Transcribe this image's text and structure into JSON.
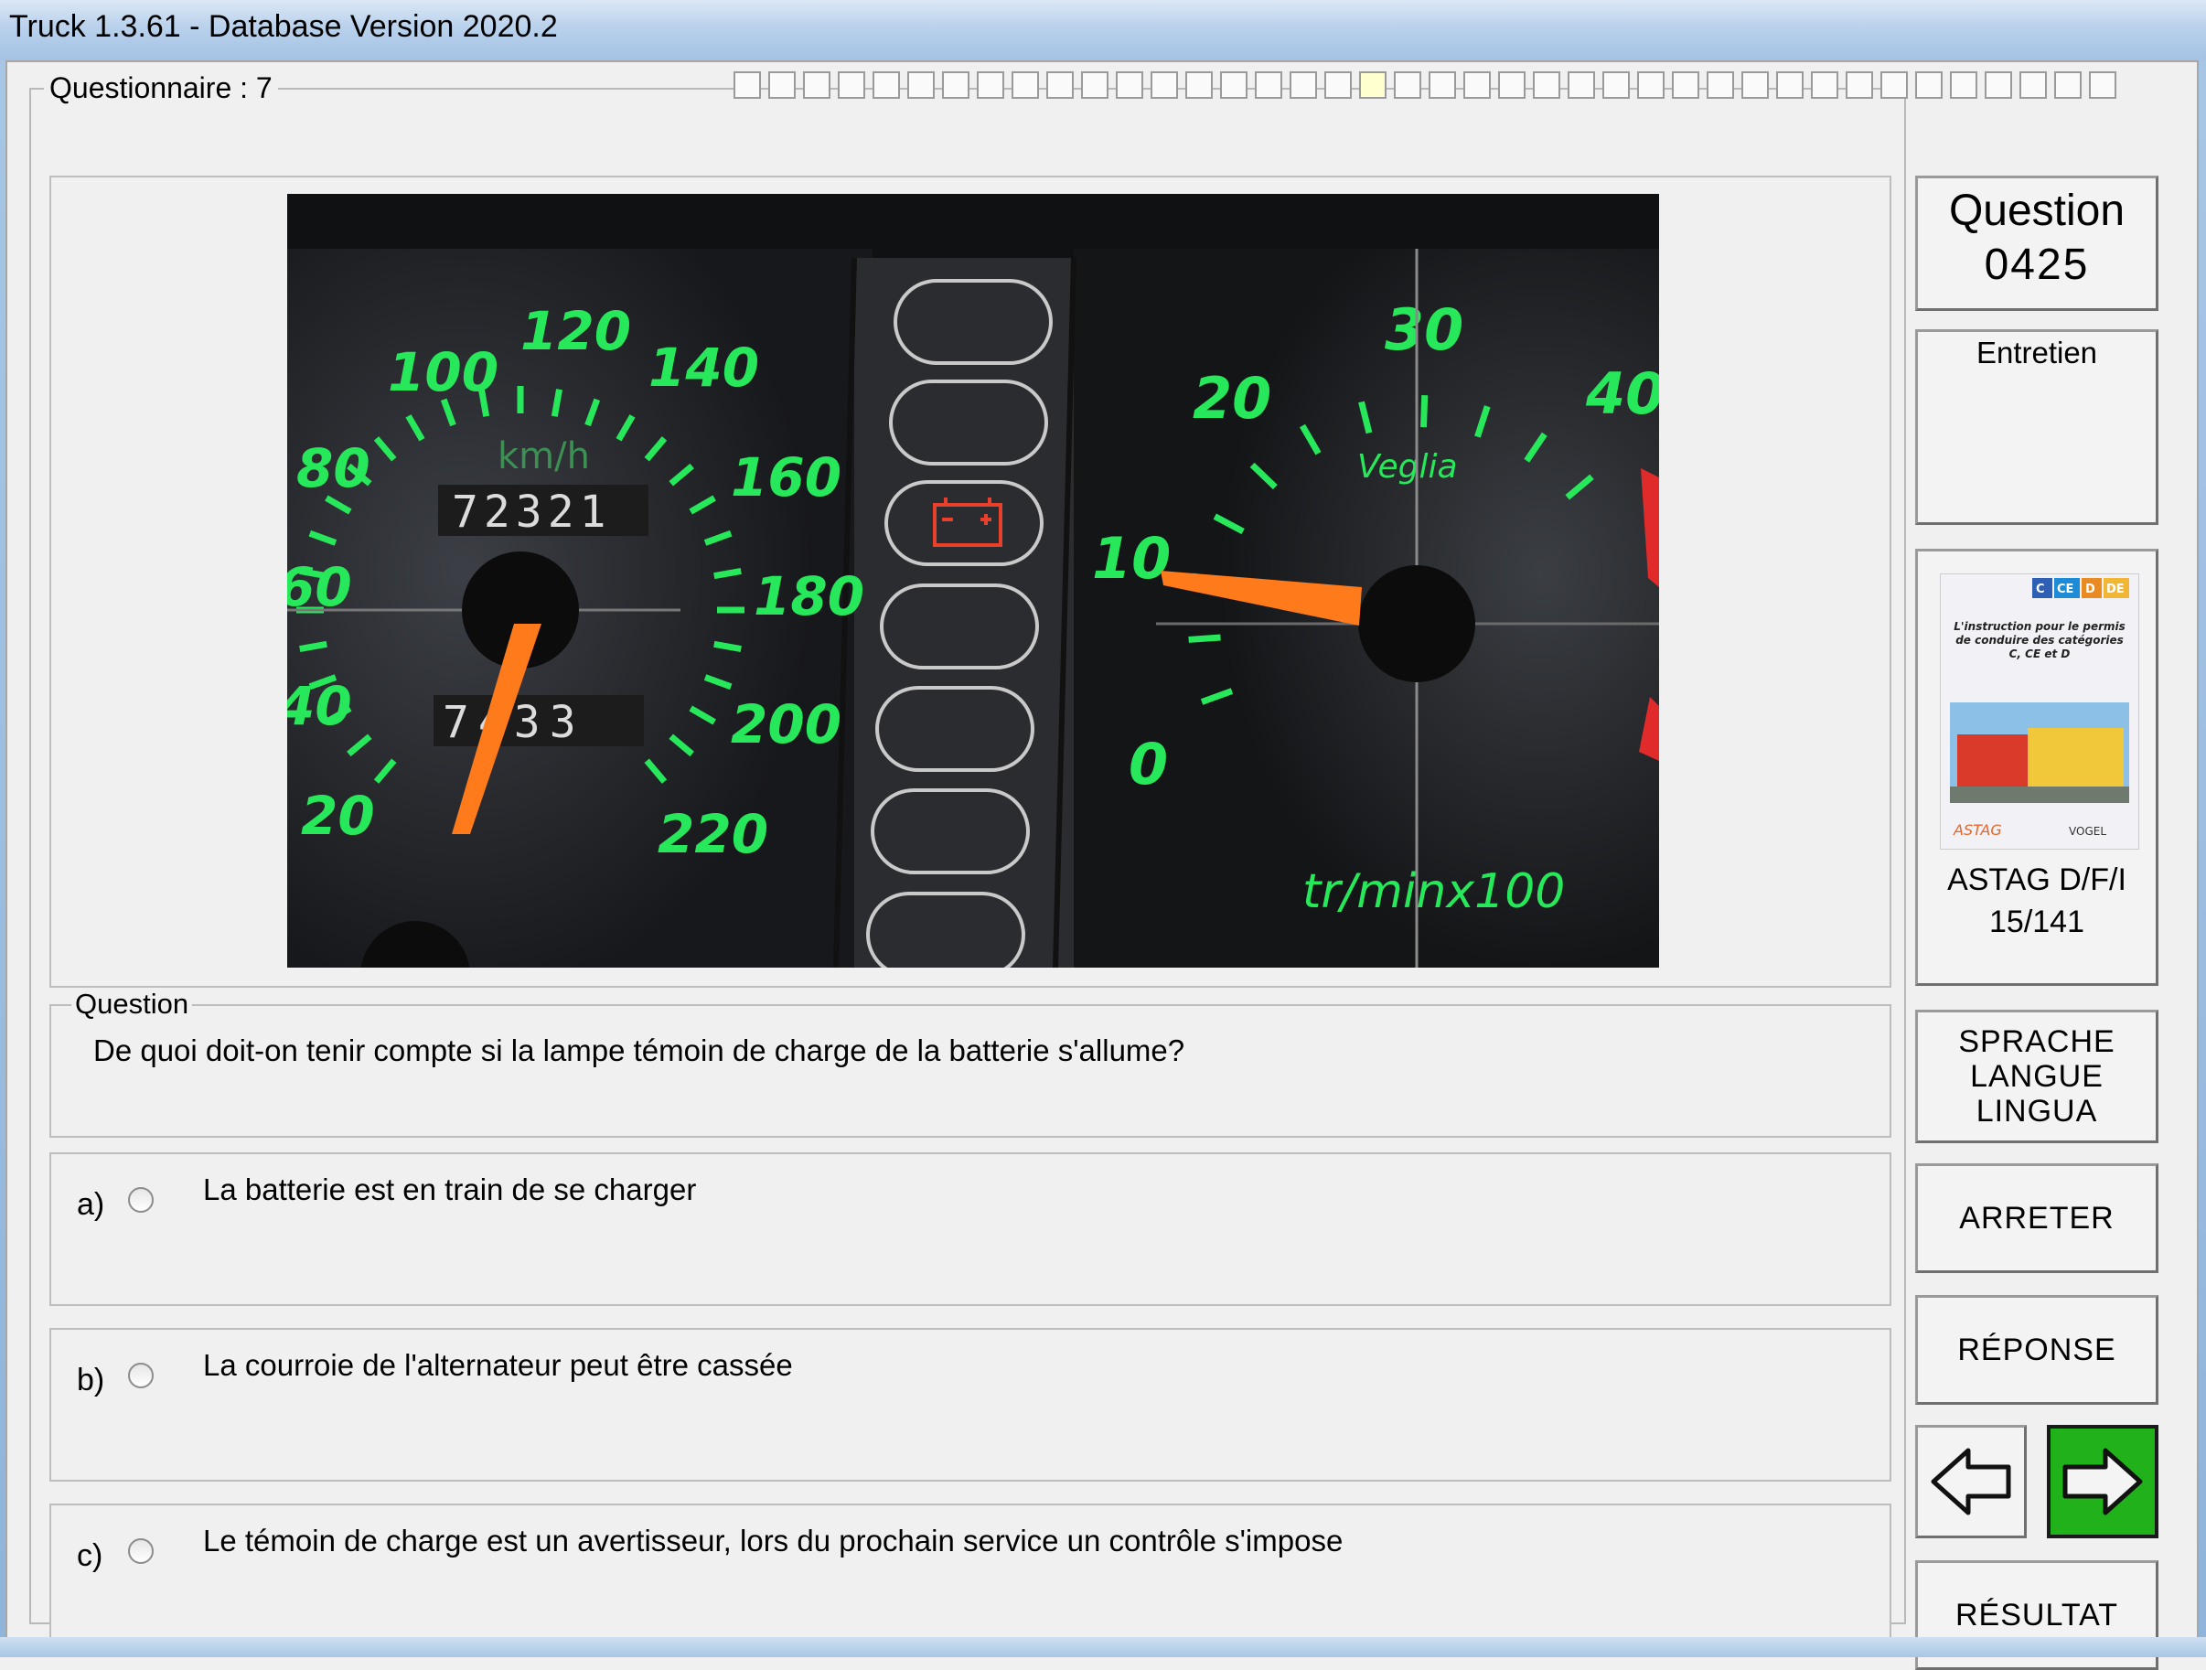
{
  "window": {
    "title": "Truck 1.3.61 - Database Version 2020.2"
  },
  "questionnaire": {
    "legend": "Questionnaire : 7",
    "progress_total": 40,
    "progress_current_index": 18
  },
  "dashboard": {
    "speed_labels": [
      "20",
      "40",
      "60",
      "80",
      "100",
      "120",
      "140",
      "160",
      "180",
      "200",
      "220"
    ],
    "speed_unit": "km/h",
    "odometer": "72321",
    "trip": "7433",
    "rpm_labels": [
      "0",
      "10",
      "20",
      "30",
      "40"
    ],
    "brand": "Veglia",
    "rpm_unit": "tr/minx100",
    "battery_warning_color": "#e8402a",
    "gauge_color": "#27e85a",
    "needle_color": "#ff7a1a"
  },
  "question": {
    "legend": "Question",
    "text": "De quoi doit-on tenir compte si la lampe témoin de charge de la batterie s'allume?"
  },
  "answers": [
    {
      "letter": "a)",
      "text": "La batterie est en train de se charger",
      "checked": false
    },
    {
      "letter": "b)",
      "text": "La courroie de l'alternateur peut être cassée",
      "checked": false
    },
    {
      "letter": "c)",
      "text": "Le témoin de charge est un avertisseur, lors du prochain service un contrôle s'impose",
      "checked": false
    }
  ],
  "sidebar": {
    "question_label": "Question",
    "question_number": "0425",
    "category": "Entretien",
    "book": {
      "badges": [
        "C",
        "CE",
        "D",
        "DE"
      ],
      "cover_text": "L'instruction pour le permis de conduire des catégories C, CE et D",
      "publisher_left": "ASTAG",
      "publisher_right": "VOGEL",
      "label": "ASTAG D/F/I",
      "pages": "15/141"
    },
    "lang_lines": [
      "SPRACHE",
      "LANGUE",
      "LINGUA"
    ],
    "stop_label": "ARRETER",
    "response_label": "RÉPONSE",
    "result_label": "RÉSULTAT",
    "colors": {
      "next_button_bg": "#21b21b"
    }
  }
}
